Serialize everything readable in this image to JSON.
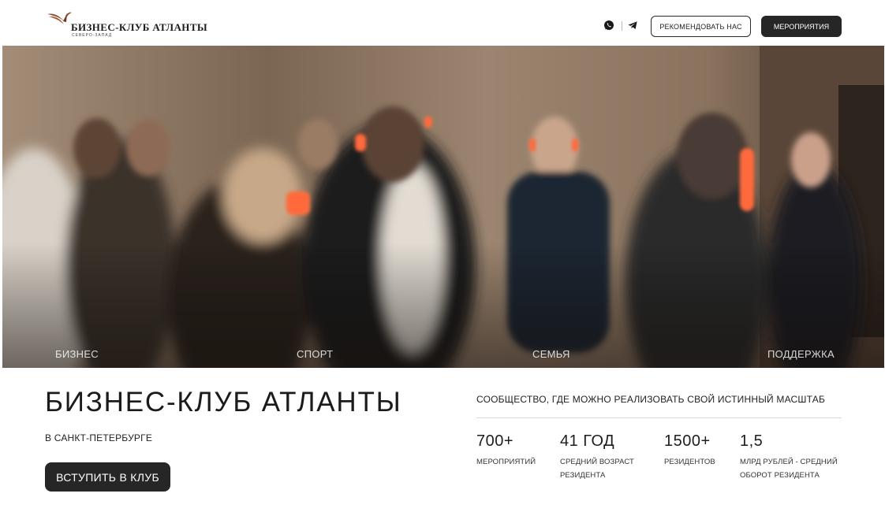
{
  "header": {
    "logo_title": "БИЗНЕС-КЛУБ АТЛАНТЫ",
    "logo_subtitle": "СЕВЕРО-ЗАПАД",
    "icons": [
      "whatsapp-icon",
      "telegram-icon"
    ],
    "recommend_label": "РЕКОМЕНДОВАТЬ НАС",
    "events_label": "МЕРОПРИЯТИЯ"
  },
  "hero": {
    "tabs": [
      "БИЗНЕС",
      "СПОРТ",
      "СЕМЬЯ",
      "ПОДДЕРЖКА"
    ]
  },
  "intro": {
    "title": "БИЗНЕС-КЛУБ АТЛАНТЫ",
    "city": "В САНКТ-ПЕТЕРБУРГЕ",
    "join_label": "ВСТУПИТЬ В КЛУБ"
  },
  "about": {
    "tagline": "СООБЩЕСТВО, ГДЕ МОЖНО РЕАЛИЗОВАТЬ СВОЙ ИСТИННЫЙ МАСШТАБ",
    "stats": [
      {
        "value": "700+",
        "label_line1": "МЕРОПРИЯТИЙ",
        "label_line2": ""
      },
      {
        "value": "41 ГОД",
        "label_line1": "СРЕДНИЙ ВОЗРАСТ",
        "label_line2": "РЕЗИДЕНТА"
      },
      {
        "value": "1500+",
        "label_line1": "РЕЗИДЕНТОВ",
        "label_line2": ""
      },
      {
        "value": "1,5",
        "label_line1": "МЛРД РУБЛЕЙ - СРЕДНИЙ",
        "label_line2": "ОБОРОТ РЕЗИДЕНТА"
      }
    ]
  },
  "colors": {
    "accent_dark": "#262626",
    "logo_accent": "#8a4b2e",
    "headphone_glow": "#ff6a3d",
    "divider": "#d8d8d8"
  }
}
